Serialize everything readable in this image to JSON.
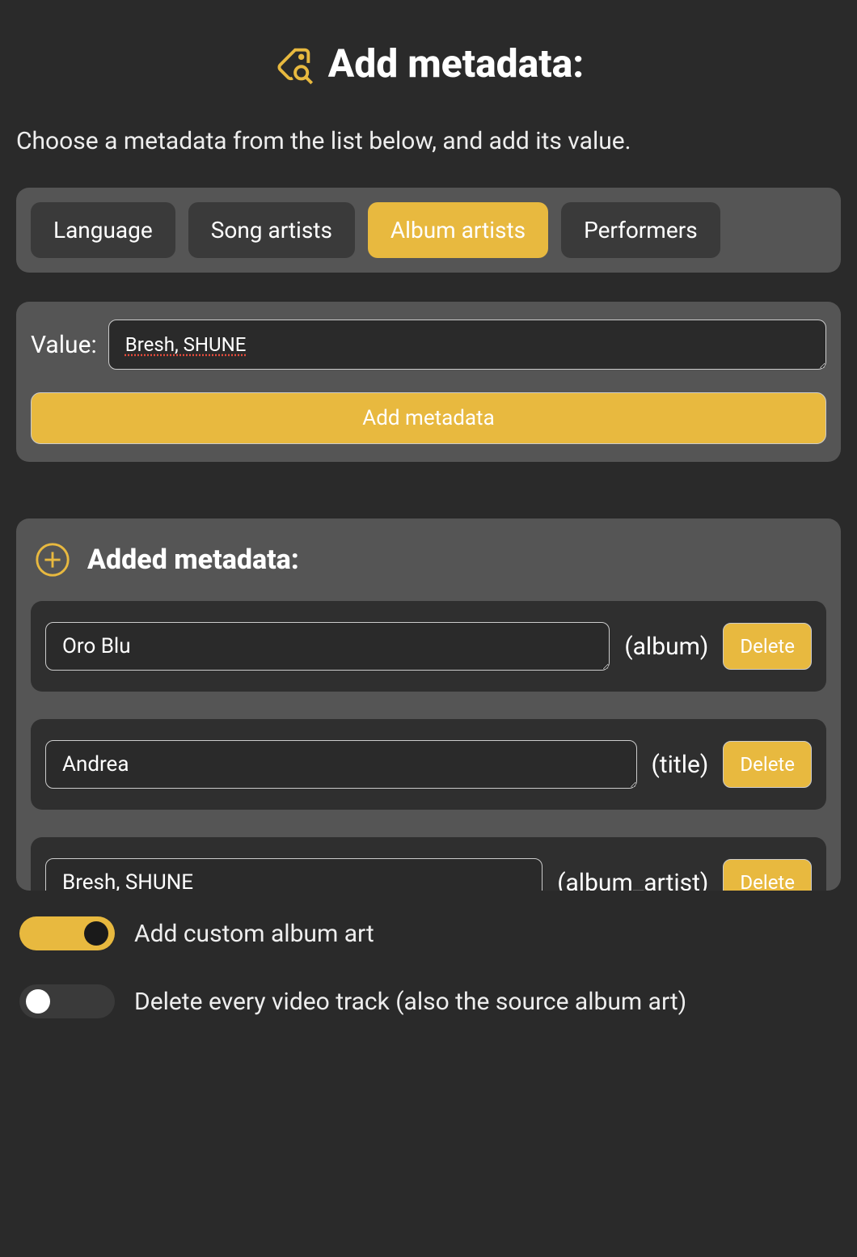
{
  "header": {
    "title": "Add metadata:"
  },
  "subtitle": "Choose a metadata from the list below, and add its value.",
  "tabs": [
    {
      "label": "Language",
      "active": false
    },
    {
      "label": "Song artists",
      "active": false
    },
    {
      "label": "Album artists",
      "active": true
    },
    {
      "label": "Performers",
      "active": false
    }
  ],
  "value_section": {
    "label": "Value:",
    "input_value": "Bresh, SHUNE",
    "button_label": "Add metadata"
  },
  "added_section": {
    "title": "Added metadata:",
    "items": [
      {
        "value": "Oro Blu",
        "type": "(album)",
        "delete_label": "Delete"
      },
      {
        "value": "Andrea",
        "type": "(title)",
        "delete_label": "Delete"
      },
      {
        "value": "Bresh, SHUNE",
        "type": "(album_artist)",
        "delete_label": "Delete"
      }
    ]
  },
  "toggles": [
    {
      "label": "Add custom album art",
      "on": true
    },
    {
      "label": "Delete every video track (also the source album art)",
      "on": false
    }
  ],
  "colors": {
    "accent": "#e8b93f",
    "bg": "#2a2a2a",
    "panel": "#555"
  }
}
